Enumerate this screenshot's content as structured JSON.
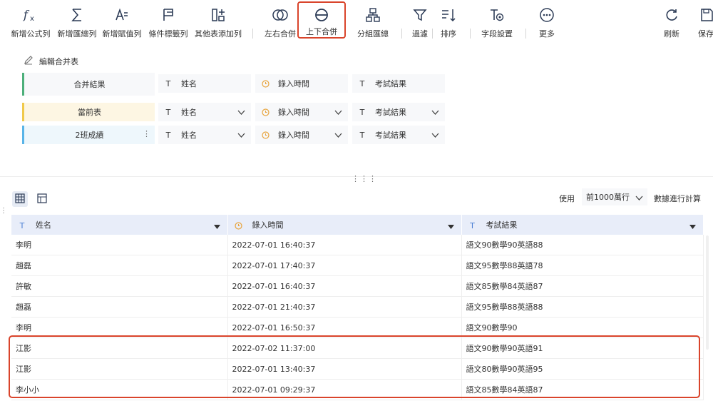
{
  "toolbar": {
    "items": [
      {
        "label": "新增公式列",
        "icon": "formula-icon"
      },
      {
        "label": "新增匯總列",
        "icon": "sum-icon"
      },
      {
        "label": "新增賦值列",
        "icon": "assign-icon"
      },
      {
        "label": "條件標籤列",
        "icon": "flag-icon"
      },
      {
        "label": "其他表添加列",
        "icon": "add-column-icon"
      },
      {
        "label": "左右合併",
        "icon": "merge-horizontal-icon"
      },
      {
        "label": "上下合併",
        "icon": "merge-vertical-icon"
      },
      {
        "label": "分組匯總",
        "icon": "group-icon"
      },
      {
        "label": "過濾",
        "icon": "filter-icon"
      },
      {
        "label": "排序",
        "icon": "sort-icon"
      },
      {
        "label": "字段設置",
        "icon": "field-settings-icon"
      },
      {
        "label": "更多",
        "icon": "more-icon"
      },
      {
        "label": "刷新",
        "icon": "refresh-icon"
      },
      {
        "label": "保存",
        "icon": "save-icon"
      }
    ]
  },
  "merge_panel": {
    "title": "編輯合并表",
    "rows": [
      {
        "name": "合并結果",
        "fields": [
          "姓名",
          "錄入時間",
          "考試結果"
        ]
      },
      {
        "name": "當前表",
        "fields": [
          "姓名",
          "錄入時間",
          "考試結果"
        ]
      },
      {
        "name": "2班成績",
        "fields": [
          "姓名",
          "錄入時間",
          "考試結果"
        ]
      }
    ]
  },
  "data_view": {
    "use_label": "使用",
    "row_limit": "前1000萬行",
    "compute_label": "數據進行計算"
  },
  "table": {
    "headers": [
      "姓名",
      "錄入時間",
      "考試結果"
    ],
    "rows": [
      [
        "李明",
        "2022-07-01 16:40:37",
        "語文90數學90英語88"
      ],
      [
        "趙磊",
        "2022-07-01 17:40:37",
        "語文95數學88英語78"
      ],
      [
        "許敏",
        "2022-07-01 16:40:37",
        "語文85數學84英語87"
      ],
      [
        "趙磊",
        "2022-07-01 21:40:37",
        "語文95數學88英語88"
      ],
      [
        "李明",
        "2022-07-01 16:50:37",
        "語文90數學90"
      ],
      [
        "江影",
        "2022-07-02 11:37:00",
        "語文90數學90英語91"
      ],
      [
        "江影",
        "2022-07-01 13:40:37",
        "語文80數學90英語95"
      ],
      [
        "李小小",
        "2022-07-01 09:29:37",
        "語文85數學84英語87"
      ]
    ]
  },
  "colors": {
    "highlight": "#d9442b",
    "result_row": "#4caf7a",
    "current_row": "#f0c94a",
    "class2_row": "#58b4e8",
    "header_bg": "#e8edf9"
  }
}
